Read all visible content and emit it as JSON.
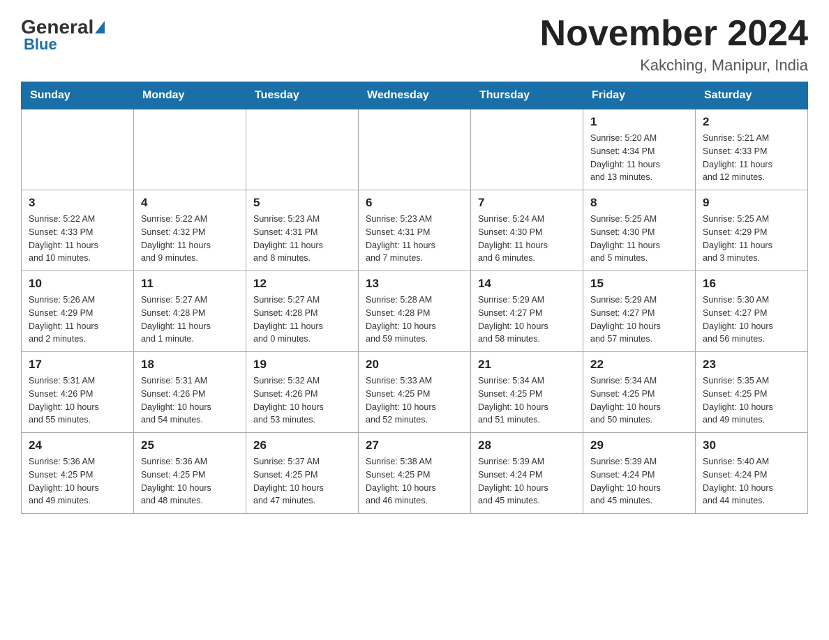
{
  "logo": {
    "general": "General",
    "blue": "Blue"
  },
  "title": "November 2024",
  "location": "Kakching, Manipur, India",
  "days_of_week": [
    "Sunday",
    "Monday",
    "Tuesday",
    "Wednesday",
    "Thursday",
    "Friday",
    "Saturday"
  ],
  "weeks": [
    [
      {
        "day": "",
        "info": ""
      },
      {
        "day": "",
        "info": ""
      },
      {
        "day": "",
        "info": ""
      },
      {
        "day": "",
        "info": ""
      },
      {
        "day": "",
        "info": ""
      },
      {
        "day": "1",
        "info": "Sunrise: 5:20 AM\nSunset: 4:34 PM\nDaylight: 11 hours\nand 13 minutes."
      },
      {
        "day": "2",
        "info": "Sunrise: 5:21 AM\nSunset: 4:33 PM\nDaylight: 11 hours\nand 12 minutes."
      }
    ],
    [
      {
        "day": "3",
        "info": "Sunrise: 5:22 AM\nSunset: 4:33 PM\nDaylight: 11 hours\nand 10 minutes."
      },
      {
        "day": "4",
        "info": "Sunrise: 5:22 AM\nSunset: 4:32 PM\nDaylight: 11 hours\nand 9 minutes."
      },
      {
        "day": "5",
        "info": "Sunrise: 5:23 AM\nSunset: 4:31 PM\nDaylight: 11 hours\nand 8 minutes."
      },
      {
        "day": "6",
        "info": "Sunrise: 5:23 AM\nSunset: 4:31 PM\nDaylight: 11 hours\nand 7 minutes."
      },
      {
        "day": "7",
        "info": "Sunrise: 5:24 AM\nSunset: 4:30 PM\nDaylight: 11 hours\nand 6 minutes."
      },
      {
        "day": "8",
        "info": "Sunrise: 5:25 AM\nSunset: 4:30 PM\nDaylight: 11 hours\nand 5 minutes."
      },
      {
        "day": "9",
        "info": "Sunrise: 5:25 AM\nSunset: 4:29 PM\nDaylight: 11 hours\nand 3 minutes."
      }
    ],
    [
      {
        "day": "10",
        "info": "Sunrise: 5:26 AM\nSunset: 4:29 PM\nDaylight: 11 hours\nand 2 minutes."
      },
      {
        "day": "11",
        "info": "Sunrise: 5:27 AM\nSunset: 4:28 PM\nDaylight: 11 hours\nand 1 minute."
      },
      {
        "day": "12",
        "info": "Sunrise: 5:27 AM\nSunset: 4:28 PM\nDaylight: 11 hours\nand 0 minutes."
      },
      {
        "day": "13",
        "info": "Sunrise: 5:28 AM\nSunset: 4:28 PM\nDaylight: 10 hours\nand 59 minutes."
      },
      {
        "day": "14",
        "info": "Sunrise: 5:29 AM\nSunset: 4:27 PM\nDaylight: 10 hours\nand 58 minutes."
      },
      {
        "day": "15",
        "info": "Sunrise: 5:29 AM\nSunset: 4:27 PM\nDaylight: 10 hours\nand 57 minutes."
      },
      {
        "day": "16",
        "info": "Sunrise: 5:30 AM\nSunset: 4:27 PM\nDaylight: 10 hours\nand 56 minutes."
      }
    ],
    [
      {
        "day": "17",
        "info": "Sunrise: 5:31 AM\nSunset: 4:26 PM\nDaylight: 10 hours\nand 55 minutes."
      },
      {
        "day": "18",
        "info": "Sunrise: 5:31 AM\nSunset: 4:26 PM\nDaylight: 10 hours\nand 54 minutes."
      },
      {
        "day": "19",
        "info": "Sunrise: 5:32 AM\nSunset: 4:26 PM\nDaylight: 10 hours\nand 53 minutes."
      },
      {
        "day": "20",
        "info": "Sunrise: 5:33 AM\nSunset: 4:25 PM\nDaylight: 10 hours\nand 52 minutes."
      },
      {
        "day": "21",
        "info": "Sunrise: 5:34 AM\nSunset: 4:25 PM\nDaylight: 10 hours\nand 51 minutes."
      },
      {
        "day": "22",
        "info": "Sunrise: 5:34 AM\nSunset: 4:25 PM\nDaylight: 10 hours\nand 50 minutes."
      },
      {
        "day": "23",
        "info": "Sunrise: 5:35 AM\nSunset: 4:25 PM\nDaylight: 10 hours\nand 49 minutes."
      }
    ],
    [
      {
        "day": "24",
        "info": "Sunrise: 5:36 AM\nSunset: 4:25 PM\nDaylight: 10 hours\nand 49 minutes."
      },
      {
        "day": "25",
        "info": "Sunrise: 5:36 AM\nSunset: 4:25 PM\nDaylight: 10 hours\nand 48 minutes."
      },
      {
        "day": "26",
        "info": "Sunrise: 5:37 AM\nSunset: 4:25 PM\nDaylight: 10 hours\nand 47 minutes."
      },
      {
        "day": "27",
        "info": "Sunrise: 5:38 AM\nSunset: 4:25 PM\nDaylight: 10 hours\nand 46 minutes."
      },
      {
        "day": "28",
        "info": "Sunrise: 5:39 AM\nSunset: 4:24 PM\nDaylight: 10 hours\nand 45 minutes."
      },
      {
        "day": "29",
        "info": "Sunrise: 5:39 AM\nSunset: 4:24 PM\nDaylight: 10 hours\nand 45 minutes."
      },
      {
        "day": "30",
        "info": "Sunrise: 5:40 AM\nSunset: 4:24 PM\nDaylight: 10 hours\nand 44 minutes."
      }
    ]
  ]
}
